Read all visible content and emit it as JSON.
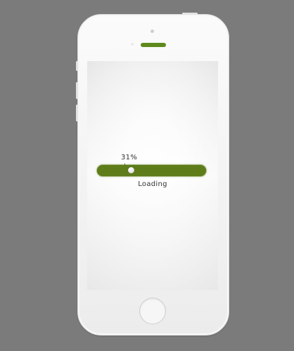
{
  "loader": {
    "percent_label": "31%",
    "progress": 0.31,
    "status_label": "Loading",
    "accent_color": "#5e7d1a"
  },
  "device": {
    "speaker_color": "#5e8a1b"
  }
}
